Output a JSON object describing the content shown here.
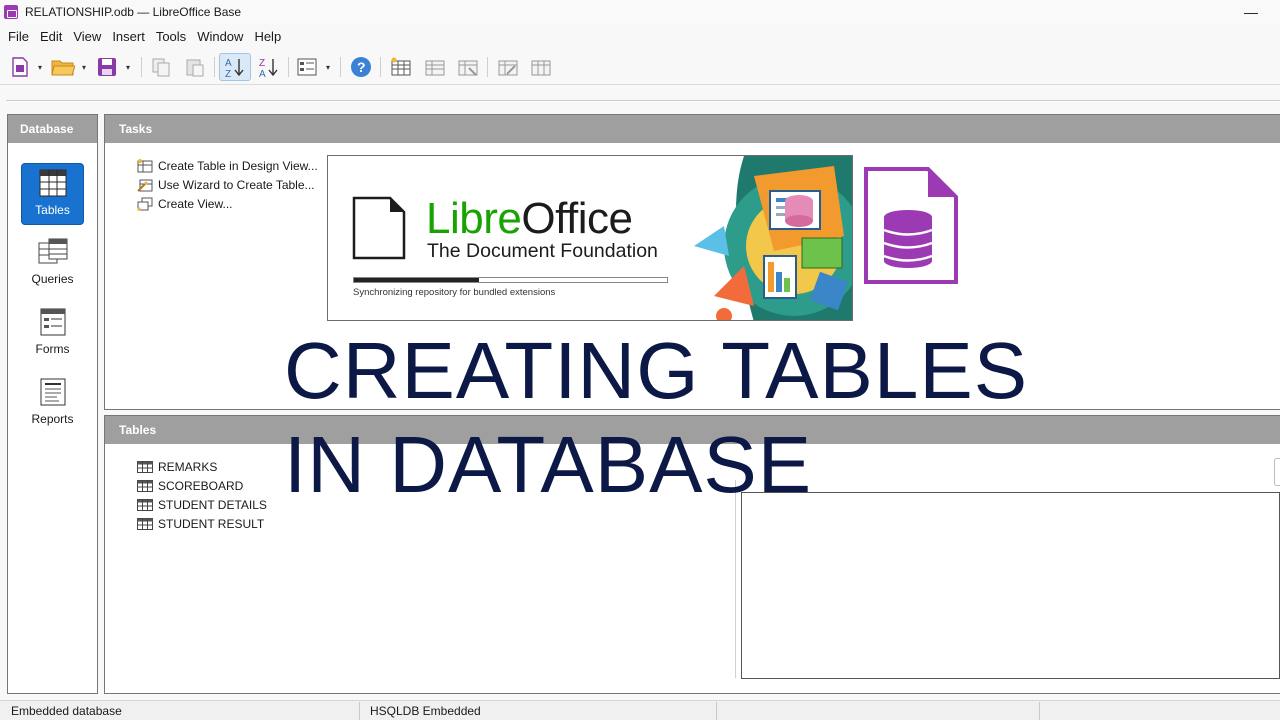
{
  "window": {
    "title": "RELATIONSHIP.odb — LibreOffice Base",
    "minimize_glyph": "—"
  },
  "menu": [
    "File",
    "Edit",
    "View",
    "Insert",
    "Tools",
    "Window",
    "Help"
  ],
  "toolbar": {
    "items": [
      "new-document-icon",
      "open-folder-icon",
      "save-icon",
      "copy-icon",
      "paste-icon",
      "sort-ascending-icon",
      "sort-descending-icon",
      "form-view-icon",
      "help-icon",
      "new-table-icon",
      "edit-table-icon",
      "delete-table-icon",
      "rename-table-icon",
      "table-properties-icon"
    ],
    "sort_asc_glyph": "↓",
    "sort_desc_glyph": "↓",
    "help_glyph": "?",
    "dropdown_glyph": "▾"
  },
  "database_panel": {
    "header": "Database",
    "items": [
      {
        "label": "Tables",
        "icon": "tables-icon",
        "selected": true
      },
      {
        "label": "Queries",
        "icon": "queries-icon",
        "selected": false
      },
      {
        "label": "Forms",
        "icon": "forms-icon",
        "selected": false
      },
      {
        "label": "Reports",
        "icon": "reports-icon",
        "selected": false
      }
    ]
  },
  "tasks_panel": {
    "header": "Tasks",
    "items": [
      {
        "label": "Create Table in Design View...",
        "icon": "design-view-icon"
      },
      {
        "label": "Use Wizard to Create Table...",
        "icon": "wizard-icon"
      },
      {
        "label": "Create View...",
        "icon": "create-view-icon"
      }
    ]
  },
  "tables_panel": {
    "header": "Tables",
    "rows": [
      "REMARKS",
      "SCOREBOARD",
      "STUDENT DETAILS",
      "STUDENT RESULT"
    ]
  },
  "splash": {
    "brand_libre": "Libre",
    "brand_office": "Office",
    "tagline": "The Document Foundation",
    "progress_fraction": 0.4,
    "status": "Synchronizing repository for bundled extensions",
    "brand_color": "#18a303"
  },
  "overlay": {
    "line1": "CREATING TABLES",
    "line2": "IN DATABASE",
    "color": "#0c1845"
  },
  "statusbar": {
    "left": "Embedded database",
    "middle": "HSQLDB Embedded"
  }
}
